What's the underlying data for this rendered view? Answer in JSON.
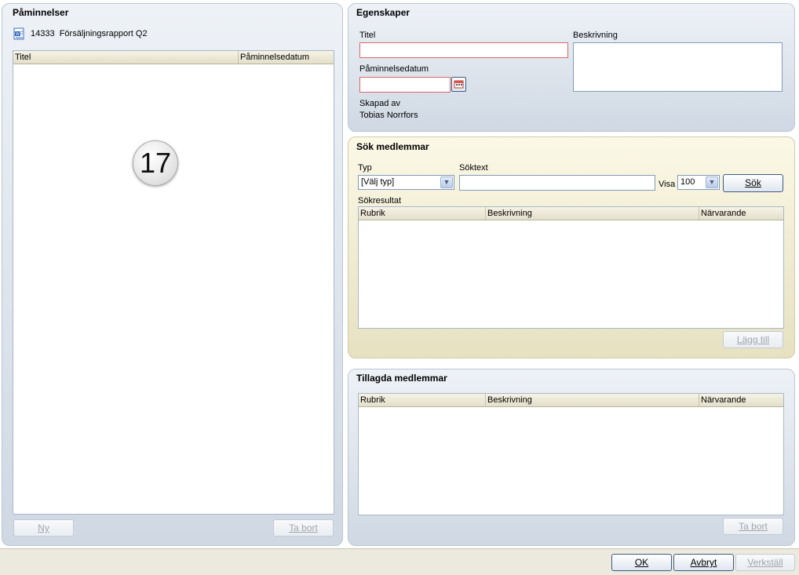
{
  "reminders": {
    "title": "Påminnelser",
    "item": {
      "icon": "word-document-icon",
      "text": "14333  Försäljningsrapport Q2"
    },
    "columns": [
      "Titel",
      "Påminnelsedatum"
    ],
    "badge": "17",
    "new_label": "Ny",
    "remove_label": "Ta bort"
  },
  "properties": {
    "title": "Egenskaper",
    "title_label": "Titel",
    "title_value": "",
    "description_label": "Beskrivning",
    "reminder_date_label": "Påminnelsedatum",
    "calendar_icon": "calendar-icon",
    "created_by_label": "Skapad av",
    "created_by": "Tobias Norrfors"
  },
  "search": {
    "title": "Sök medlemmar",
    "type_label": "Typ",
    "type_value": "[Välj typ]",
    "text_label": "Söktext",
    "text_value": "",
    "show_label": "Visa",
    "show_value": "100",
    "search_button": "Sök",
    "results_label": "Sökresultat",
    "columns": [
      "Rubrik",
      "Beskrivning",
      "Närvarande"
    ],
    "add_button": "Lägg till"
  },
  "added": {
    "title": "Tillagda medlemmar",
    "columns": [
      "Rubrik",
      "Beskrivning",
      "Närvarande"
    ],
    "remove_button": "Ta bort"
  },
  "footer": {
    "ok": "OK",
    "cancel": "Avbryt",
    "apply": "Verkställ"
  }
}
